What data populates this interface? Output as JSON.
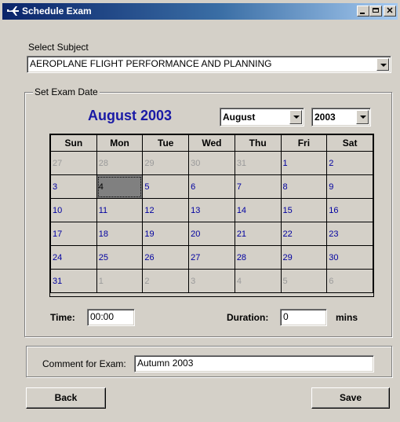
{
  "window": {
    "title": "Schedule Exam"
  },
  "subject": {
    "label": "Select Subject",
    "value": "AEROPLANE FLIGHT PERFORMANCE AND PLANNING"
  },
  "exam_date": {
    "group_label": "Set Exam Date",
    "heading": "August 2003",
    "month_select": "August",
    "year_select": "2003",
    "weekdays": [
      "Sun",
      "Mon",
      "Tue",
      "Wed",
      "Thu",
      "Fri",
      "Sat"
    ],
    "weeks": [
      [
        "27",
        "28",
        "29",
        "30",
        "31",
        "1",
        "2"
      ],
      [
        "3",
        "4",
        "5",
        "6",
        "7",
        "8",
        "9"
      ],
      [
        "10",
        "11",
        "12",
        "13",
        "14",
        "15",
        "16"
      ],
      [
        "17",
        "18",
        "19",
        "20",
        "21",
        "22",
        "23"
      ],
      [
        "24",
        "25",
        "26",
        "27",
        "28",
        "29",
        "30"
      ],
      [
        "31",
        "1",
        "2",
        "3",
        "4",
        "5",
        "6"
      ]
    ],
    "selected_day": "4",
    "time_label": "Time:",
    "time_value": "00:00",
    "duration_label": "Duration:",
    "duration_value": "0",
    "duration_unit": "mins"
  },
  "comment": {
    "label": "Comment for Exam:",
    "value": "Autumn 2003"
  },
  "buttons": {
    "back": "Back",
    "save": "Save"
  },
  "colors": {
    "accent": "#1a1aa6",
    "day_current": "#0000a0",
    "day_other": "#9a9a9a"
  }
}
